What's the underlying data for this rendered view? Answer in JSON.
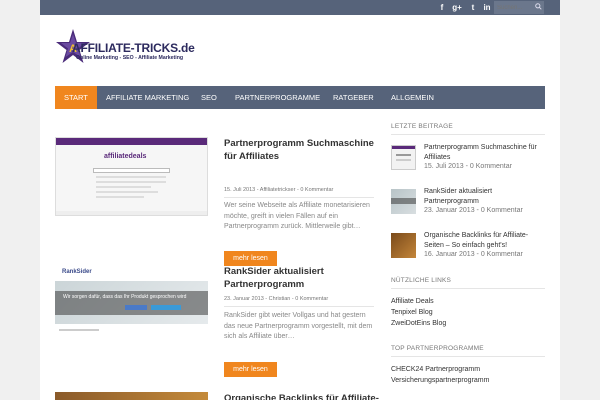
{
  "topbar": {
    "social": [
      "f",
      "g+",
      "t",
      "in"
    ],
    "search_placeholder": "Suchen..."
  },
  "logo": {
    "title": "AFFILIATE-TRICKS.de",
    "tagline": "Online Marketing - SEO - Affiliate Marketing"
  },
  "nav": [
    "START",
    "AFFILIATE MARKETING",
    "SEO",
    "PARTNERPROGRAMME",
    "RATGEBER",
    "ALLGEMEIN"
  ],
  "posts": [
    {
      "title": "Partnerprogramm Suchmaschine für Affiliates",
      "meta": "15. Juli 2013 - Affiliatetrickser - 0 Kommentar",
      "excerpt": "Wer seine Webseite als Affiliate monetarisieren möchte, greift in vielen Fällen auf ein Partnerprogramm zurück. Mittlerweile gibt…",
      "thumb_label": "affiliatedeals",
      "button": "mehr lesen"
    },
    {
      "title": "RankSider aktualisiert Partnerprogramm",
      "meta": "23. Januar 2013 - Christian - 0 Kommentar",
      "excerpt": "RankSider gibt weiter Vollgas und hat gestern das neue Partnerprogramm vorgestellt, mit dem sich als Affiliate über…",
      "thumb_label": "RankSider",
      "thumb_text": "Wir sorgen dafür, dass das Ihr Produkt gesprochen wird",
      "button": "mehr lesen"
    },
    {
      "title": "Organische Backlinks für Affiliate-"
    }
  ],
  "sidebar": {
    "recent_title": "LETZTE BEITRAGE",
    "recent": [
      {
        "title": "Partnerprogramm Suchmaschine für Affiliates",
        "meta": "15. Juli 2013 - 0 Kommentar"
      },
      {
        "title": "RankSider aktualisiert Partnerprogramm",
        "meta": "23. Januar 2013 - 0 Kommentar"
      },
      {
        "title": "Organische Backlinks für Affiliate-Seiten – So einfach geht's!",
        "meta": "16. Januar 2013 - 0 Kommentar"
      }
    ],
    "links_title": "NÜTZLICHE LINKS",
    "links": [
      "Affiliate Deals",
      "Tenpixel Blog",
      "ZweiDotEins Blog"
    ],
    "top_title": "TOP PARTNERPROGRAMME",
    "top": [
      "CHECK24 Partnerprogramm",
      "Versicherungspartnerprogramm"
    ]
  }
}
